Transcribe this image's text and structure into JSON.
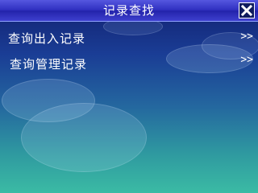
{
  "window": {
    "title": "记录查找"
  },
  "menu": {
    "items": [
      {
        "label": "查询出入记录",
        "arrow": ">>"
      },
      {
        "label": "查询管理记录",
        "arrow": ">>"
      }
    ]
  },
  "icons": {
    "close": "close-icon"
  },
  "colors": {
    "title_bar": "#2f2fc0",
    "background_top": "#12206f",
    "background_bottom": "#3bbba4",
    "text": "#ffffff"
  }
}
